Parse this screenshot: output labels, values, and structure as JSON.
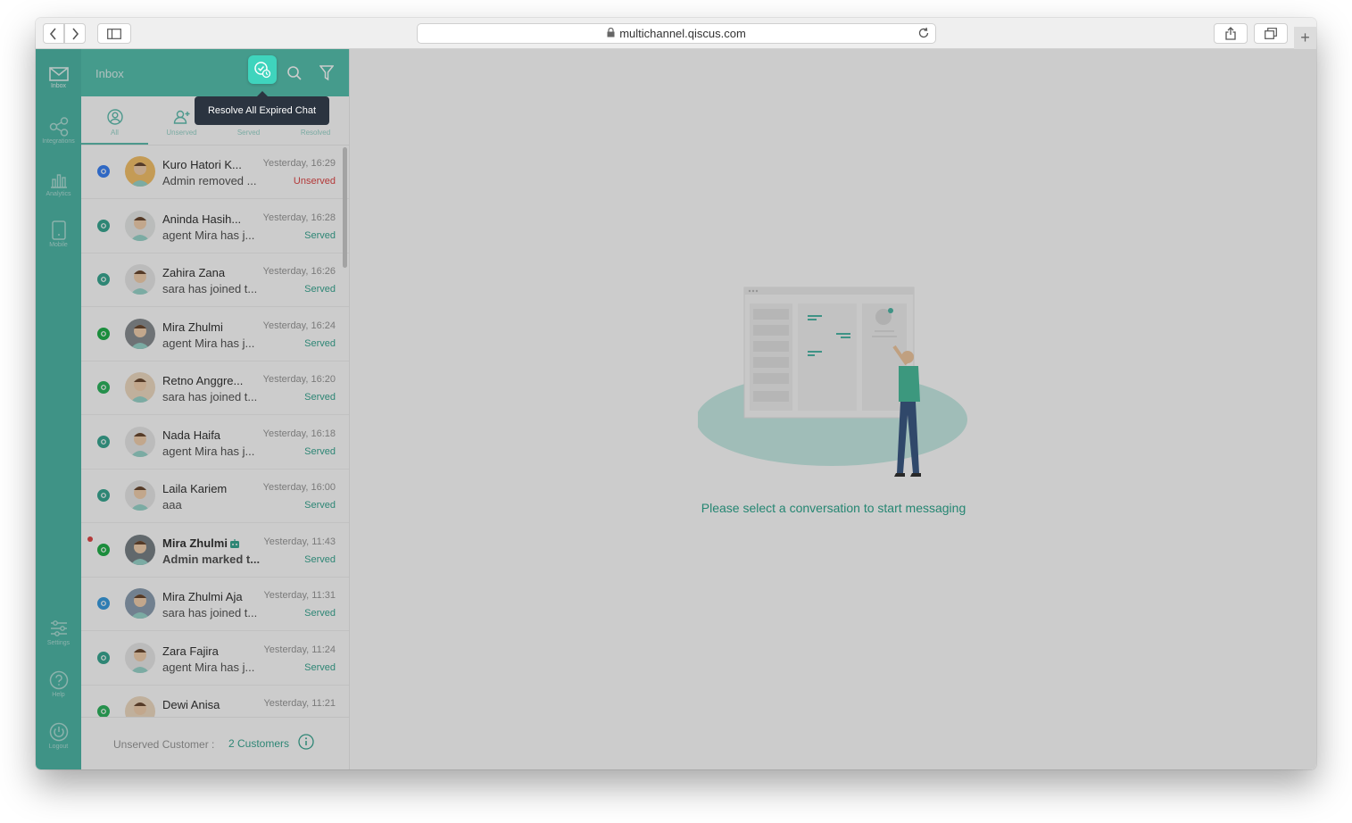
{
  "browser": {
    "url": "multichannel.qiscus.com"
  },
  "nav": {
    "items": [
      {
        "label": "Inbox",
        "icon": "mail-icon"
      },
      {
        "label": "Integrations",
        "icon": "share-icon"
      },
      {
        "label": "Analytics",
        "icon": "bar-chart-icon"
      },
      {
        "label": "Mobile",
        "icon": "mobile-icon"
      }
    ],
    "bottom_items": [
      {
        "label": "Settings",
        "icon": "sliders-icon"
      },
      {
        "label": "Help",
        "icon": "help-icon"
      },
      {
        "label": "Logout",
        "icon": "power-icon"
      }
    ]
  },
  "inbox": {
    "title": "Inbox",
    "tooltip": "Resolve All Expired Chat",
    "tabs": [
      {
        "label": "All"
      },
      {
        "label": "Unserved"
      },
      {
        "label": "Served"
      },
      {
        "label": "Resolved"
      }
    ]
  },
  "conversations": [
    {
      "name": "Kuro Hatori K...",
      "preview": "Admin removed ...",
      "time": "Yesterday, 16:29",
      "status": "Unserved",
      "channel": "messenger"
    },
    {
      "name": "Aninda Hasih...",
      "preview": "agent Mira has j...",
      "time": "Yesterday, 16:28",
      "status": "Served",
      "channel": "qiscus"
    },
    {
      "name": "Zahira Zana",
      "preview": "sara has joined t...",
      "time": "Yesterday, 16:26",
      "status": "Served",
      "channel": "qiscus"
    },
    {
      "name": "Mira Zhulmi",
      "preview": "agent Mira has j...",
      "time": "Yesterday, 16:24",
      "status": "Served",
      "channel": "line"
    },
    {
      "name": "Retno Anggre...",
      "preview": "sara has joined t...",
      "time": "Yesterday, 16:20",
      "status": "Served",
      "channel": "whatsapp"
    },
    {
      "name": "Nada Haifa",
      "preview": "agent Mira has j...",
      "time": "Yesterday, 16:18",
      "status": "Served",
      "channel": "qiscus"
    },
    {
      "name": "Laila Kariem",
      "preview": "aaa",
      "time": "Yesterday, 16:00",
      "status": "Served",
      "channel": "qiscus"
    },
    {
      "name": "Mira Zhulmi",
      "preview": "Admin marked t...",
      "time": "Yesterday, 11:43",
      "status": "Served",
      "channel": "line"
    },
    {
      "name": "Mira Zhulmi Aja",
      "preview": "sara has joined t...",
      "time": "Yesterday, 11:31",
      "status": "Served",
      "channel": "telegram"
    },
    {
      "name": "Zara Fajira",
      "preview": "agent Mira has j...",
      "time": "Yesterday, 11:24",
      "status": "Served",
      "channel": "qiscus"
    },
    {
      "name": "Dewi Anisa",
      "preview": "",
      "time": "Yesterday, 11:21",
      "status": "",
      "channel": "whatsapp"
    }
  ],
  "footer": {
    "label": "Unserved Customer :",
    "value": "2 Customers"
  },
  "main": {
    "empty_text": "Please select a conversation to start messaging"
  },
  "colors": {
    "brand": "#57c2b0",
    "accent": "#3fd4bd",
    "unserved": "#e04848",
    "served": "#3aa893"
  }
}
